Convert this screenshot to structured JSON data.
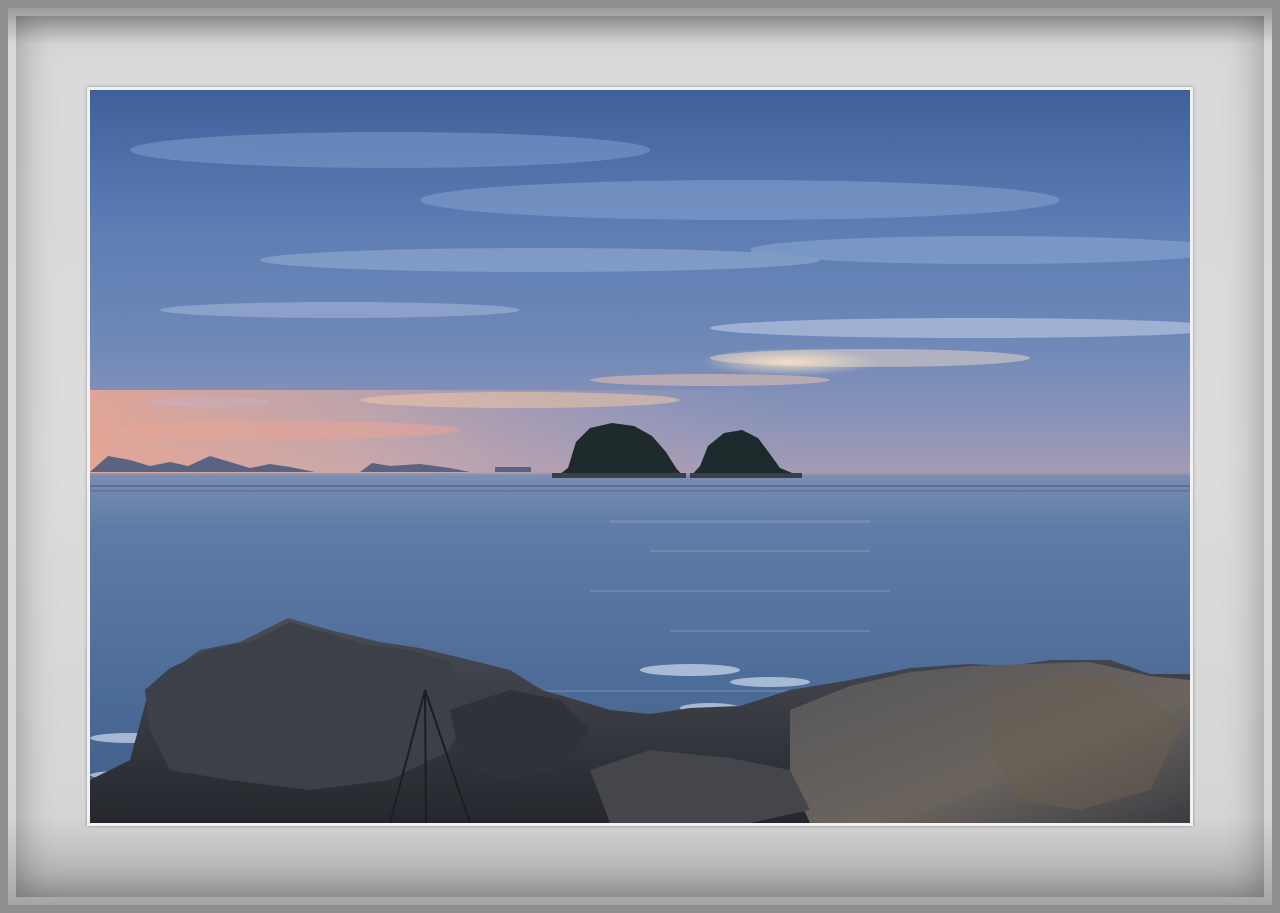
{
  "image": {
    "subject": "seascape-at-dusk",
    "palette": {
      "sky_top": "#4a6a9e",
      "sky_mid": "#6f8dbd",
      "horizon_glow": "#e9a98c",
      "sea": "#4e6d96",
      "rocks": "#3a3d44",
      "frame": "#d8d8d8"
    }
  }
}
